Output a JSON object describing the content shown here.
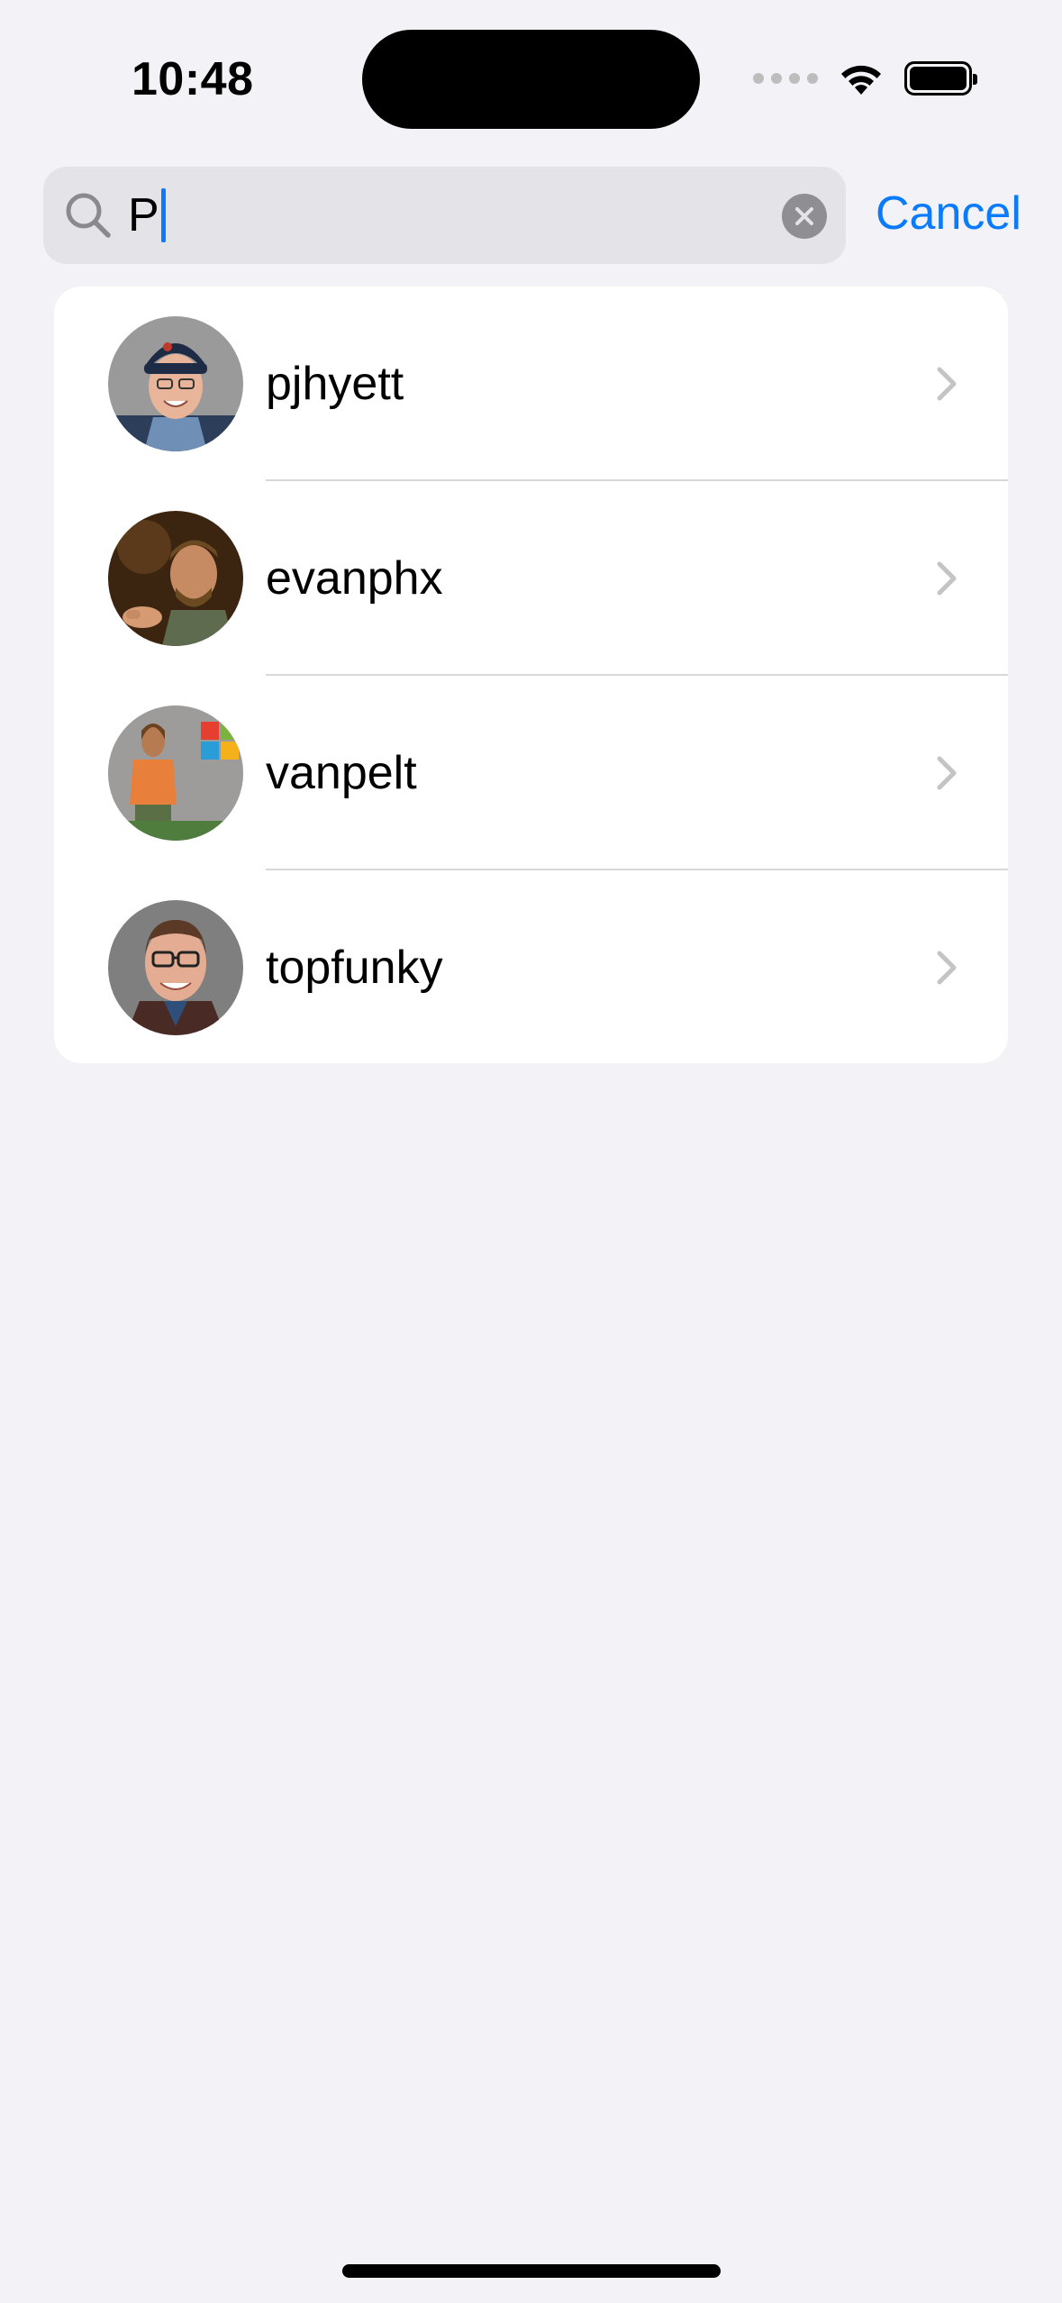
{
  "status_bar": {
    "time": "10:48",
    "icons": [
      "cellular-dots-icon",
      "wifi-icon",
      "battery-icon"
    ]
  },
  "search": {
    "value": "P",
    "search_icon": "magnifying-glass-icon",
    "clear_icon": "clear-x-icon",
    "cancel_label": "Cancel"
  },
  "results": [
    {
      "name": "pjhyett"
    },
    {
      "name": "evanphx"
    },
    {
      "name": "vanpelt"
    },
    {
      "name": "topfunky"
    }
  ],
  "colors": {
    "accent": "#0a7bfd",
    "background": "#f2f2f7",
    "search_field": "#e3e3e8",
    "chevron": "#c4c4c7"
  }
}
